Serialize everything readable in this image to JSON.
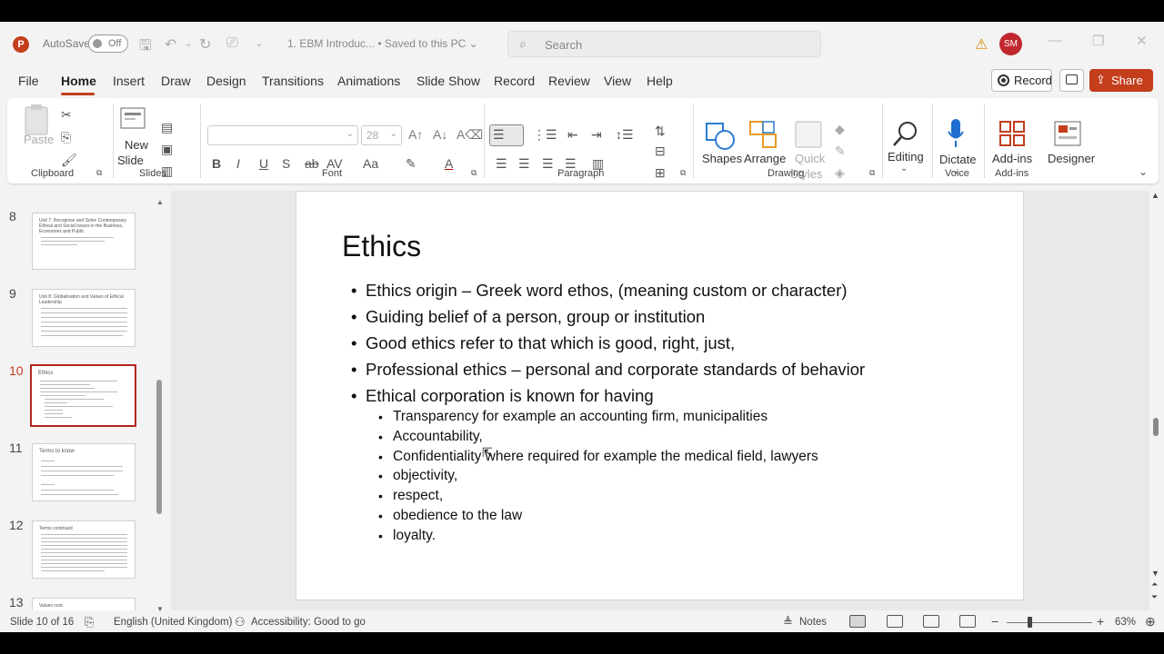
{
  "window": {
    "autosave_label": "AutoSave",
    "autosave_state": "Off",
    "doc_title": "1. EBM Introduc... • Saved to this PC ⌄",
    "search_placeholder": "Search",
    "user_initials": "SM"
  },
  "menu": {
    "items": [
      "File",
      "Home",
      "Insert",
      "Draw",
      "Design",
      "Transitions",
      "Animations",
      "Slide Show",
      "Record",
      "Review",
      "View",
      "Help"
    ],
    "active": "Home",
    "record_label": "Record",
    "share_label": "Share"
  },
  "ribbon": {
    "groups": [
      "Clipboard",
      "Slides",
      "Font",
      "Paragraph",
      "Drawing",
      "Voice",
      "Add-ins"
    ],
    "paste_label": "Paste",
    "new_slide_label_1": "New",
    "new_slide_label_2": "Slide",
    "font_size": "28",
    "shapes_label": "Shapes",
    "arrange_label": "Arrange",
    "quick_styles_1": "Quick",
    "quick_styles_2": "Styles",
    "editing_label": "Editing",
    "dictate_label": "Dictate",
    "addins_label": "Add-ins",
    "designer_label": "Designer"
  },
  "thumbnails": [
    {
      "num": "8",
      "title": "Unit 7: Recognise and Solve Contemporary Ethical and Social Issues in the Business, Economies and Public"
    },
    {
      "num": "9",
      "title": "Unit 8: Globalisation and Values of Ethical Leadership"
    },
    {
      "num": "10",
      "title": "Ethics",
      "active": true
    },
    {
      "num": "11",
      "title": "Terms to know"
    },
    {
      "num": "12",
      "title": "Terms continued"
    },
    {
      "num": "13",
      "title": "Values cont."
    }
  ],
  "slide": {
    "title": "Ethics",
    "bullets": [
      "Ethics origin – Greek word ethos, (meaning custom or character)",
      "Guiding belief of a person, group or institution",
      "Good ethics refer to that which is good, right, just,",
      "Professional ethics – personal and corporate standards of behavior",
      "Ethical corporation is known for having"
    ],
    "sub_bullets": [
      "Transparency for example an accounting firm, municipalities",
      "Accountability,",
      "Confidentiality where required for example the medical field, lawyers",
      "objectivity,",
      "respect,",
      "obedience to the law",
      "loyalty."
    ]
  },
  "status": {
    "slide_info": "Slide 10 of 16",
    "language": "English (United Kingdom)",
    "accessibility": "Accessibility: Good to go",
    "notes_label": "Notes",
    "zoom": "63%"
  },
  "colors": {
    "accent": "#c43e1c",
    "active_thumb_border": "#b1271f"
  }
}
